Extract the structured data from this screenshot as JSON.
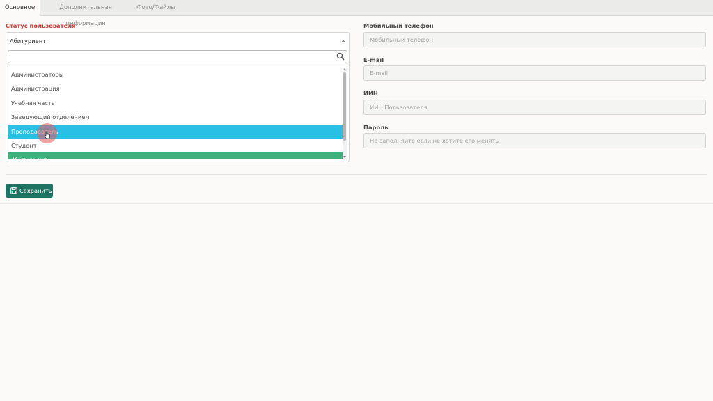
{
  "tabs": [
    {
      "label": "Основное"
    },
    {
      "label": "Дополнительная информация"
    },
    {
      "label": "Фото/Файлы"
    }
  ],
  "status": {
    "label": "Статус пользователя",
    "current": "Абитуриент",
    "search_value": "",
    "options": [
      {
        "label": "Администраторы"
      },
      {
        "label": "Администрация"
      },
      {
        "label": "Учебная часть"
      },
      {
        "label": "Заведующий отделением"
      },
      {
        "label": "Преподаватель"
      },
      {
        "label": "Студент"
      },
      {
        "label": "Абитуриент"
      }
    ]
  },
  "fields": {
    "phone": {
      "label": "Мобильный телефон",
      "placeholder": "Мобильный телефон"
    },
    "email": {
      "label": "E-mail",
      "placeholder": "E-mail"
    },
    "iin": {
      "label": "ИИН",
      "placeholder": "ИИН Пользователя"
    },
    "password": {
      "label": "Пароль",
      "placeholder": "Не заполняйте,если не хотите его менять"
    }
  },
  "actions": {
    "save_label": "Сохранить"
  },
  "colors": {
    "hover": "#29c0e6",
    "selected": "#3bb27c",
    "save": "#1e7461",
    "required": "#c8433a"
  }
}
